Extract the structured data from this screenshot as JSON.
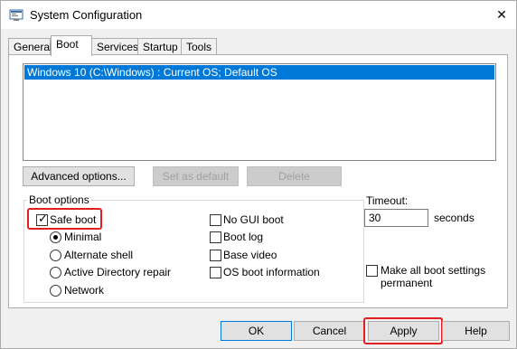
{
  "window": {
    "title": "System Configuration",
    "icon": "msconfig-icon",
    "close_glyph": "✕"
  },
  "tabs": [
    {
      "label": "General",
      "active": false
    },
    {
      "label": "Boot",
      "active": true
    },
    {
      "label": "Services",
      "active": false
    },
    {
      "label": "Startup",
      "active": false
    },
    {
      "label": "Tools",
      "active": false
    }
  ],
  "os_list": {
    "items": [
      {
        "label": "Windows 10 (C:\\Windows) : Current OS; Default OS",
        "selected": true
      }
    ]
  },
  "list_buttons": {
    "advanced": "Advanced options...",
    "set_default": "Set as default",
    "delete": "Delete"
  },
  "boot_options": {
    "label": "Boot options",
    "safe_boot": {
      "label": "Safe boot",
      "checked": true
    },
    "radios": [
      {
        "label": "Minimal",
        "selected": true
      },
      {
        "label": "Alternate shell",
        "selected": false
      },
      {
        "label": "Active Directory repair",
        "selected": false
      },
      {
        "label": "Network",
        "selected": false
      }
    ],
    "checks": [
      {
        "label": "No GUI boot",
        "checked": false
      },
      {
        "label": "Boot log",
        "checked": false
      },
      {
        "label": "Base video",
        "checked": false
      },
      {
        "label": "OS boot information",
        "checked": false
      }
    ]
  },
  "timeout": {
    "label": "Timeout:",
    "value": "30",
    "unit": "seconds"
  },
  "make_permanent": {
    "label_line1": "Make all boot settings",
    "label_line2": "permanent",
    "checked": false
  },
  "footer": {
    "ok": "OK",
    "cancel": "Cancel",
    "apply": "Apply",
    "help": "Help"
  },
  "colors": {
    "selection": "#0078d7",
    "highlight": "#e02020"
  }
}
